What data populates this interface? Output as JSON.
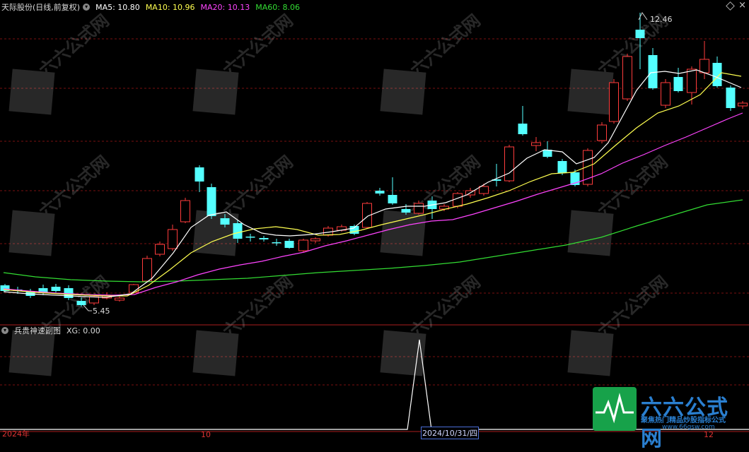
{
  "header": {
    "stock_title": "天际股份(日线,前复权)",
    "ma5": "MA5: 10.80",
    "ma10": "MA10: 10.96",
    "ma20": "MA20: 10.13",
    "ma60": "MA60: 8.06"
  },
  "colors": {
    "background": "#000000",
    "up": "#ff3c3c",
    "down": "#54ffff",
    "ma5": "#ffffff",
    "ma10": "#ffff50",
    "ma20": "#ff44ff",
    "ma60": "#33dd33",
    "grid": "#7a1111"
  },
  "price_labels": {
    "high": "12.46",
    "low": "5.45"
  },
  "indicator": {
    "title": "兵贵神速副图",
    "xg": "XG: 0.00"
  },
  "x_axis": {
    "start": "2024年",
    "m10": "10",
    "cursor_date": "2024/10/31/四",
    "m12": "12"
  },
  "watermark": {
    "title": "六六公式网",
    "subtitle": "聚焦热门精品炒股指标公式",
    "url": "www.66gsw.com"
  },
  "icons": [
    "collapse-icon",
    "diamond-icon",
    "close-icon",
    "logo-icon"
  ]
}
